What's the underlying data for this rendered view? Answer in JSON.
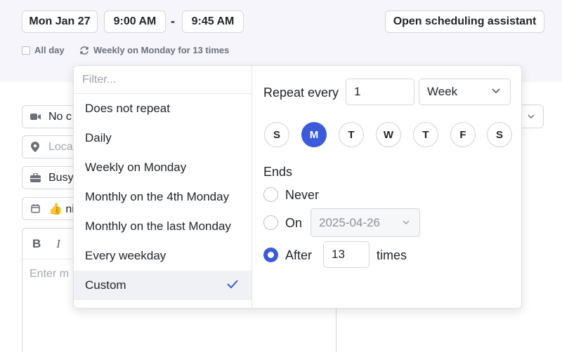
{
  "header": {
    "date": "Mon Jan 27",
    "start_time": "9:00 AM",
    "separator": "-",
    "end_time": "9:45 AM",
    "scheduling_assistant": "Open scheduling assistant",
    "all_day_label": "All day",
    "recurrence_summary": "Weekly on Monday for 13 times"
  },
  "form": {
    "conference": "No c",
    "location": "Loca",
    "status": "Busy",
    "calendar": "👍 nic",
    "editor_placeholder": "Enter m",
    "bold": "B",
    "italic": "I"
  },
  "recurrence": {
    "filter_placeholder": "Filter...",
    "options": [
      {
        "label": "Does not repeat",
        "selected": false
      },
      {
        "label": "Daily",
        "selected": false
      },
      {
        "label": "Weekly on Monday",
        "selected": false
      },
      {
        "label": "Monthly on the 4th Monday",
        "selected": false
      },
      {
        "label": "Monthly on the last Monday",
        "selected": false
      },
      {
        "label": "Every weekday",
        "selected": false
      },
      {
        "label": "Custom",
        "selected": true
      }
    ],
    "custom": {
      "repeat_every_label": "Repeat every",
      "interval": "1",
      "unit": "Week",
      "days": [
        {
          "label": "S",
          "active": false
        },
        {
          "label": "M",
          "active": true
        },
        {
          "label": "T",
          "active": false
        },
        {
          "label": "W",
          "active": false
        },
        {
          "label": "T",
          "active": false
        },
        {
          "label": "F",
          "active": false
        },
        {
          "label": "S",
          "active": false
        }
      ],
      "ends_label": "Ends",
      "never_label": "Never",
      "on_label": "On",
      "on_date": "2025-04-26",
      "after_label": "After",
      "after_count": "13",
      "times_label": "times",
      "selected_end": "after"
    }
  },
  "colors": {
    "accent": "#3b5bdb",
    "header_bg": "#f6f5fb",
    "border": "#d3d6dc"
  }
}
